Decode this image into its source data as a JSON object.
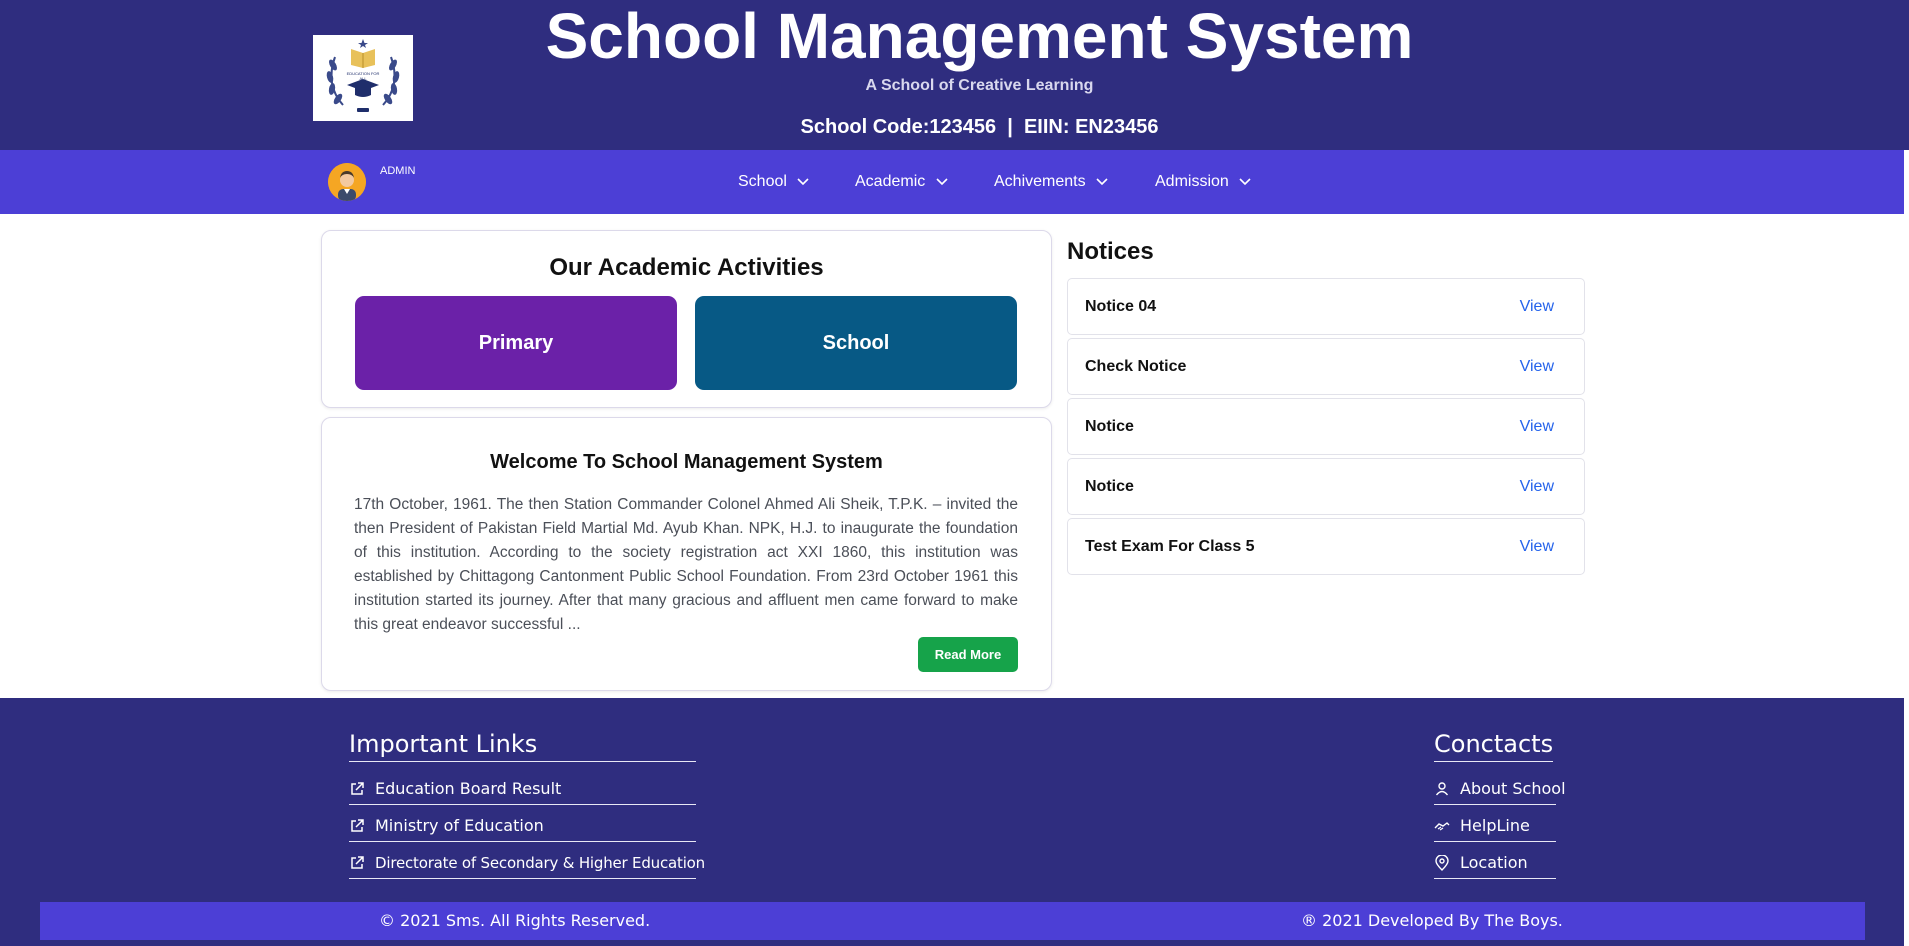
{
  "header": {
    "title": "School Management System",
    "subtitle": "A School of Creative Learning",
    "code_line": "School Code:123456  |  EIIN: EN23456",
    "logo_text": "EDUCATION FOR ALL"
  },
  "navbar": {
    "user_label": "ADMIN",
    "items": [
      {
        "label": "School"
      },
      {
        "label": "Academic"
      },
      {
        "label": "Achivements"
      },
      {
        "label": "Admission"
      }
    ]
  },
  "activities": {
    "title": "Our Academic Activities",
    "buttons": [
      {
        "label": "Primary",
        "color": "#6b21a8"
      },
      {
        "label": "School",
        "color": "#075985"
      }
    ]
  },
  "welcome": {
    "title": "Welcome To School Management System",
    "body": "17th October, 1961. The then Station Commander Colonel Ahmed Ali Sheik, T.P.K. – invited the then President of Pakistan Field Martial Md. Ayub Khan. NPK, H.J. to inaugurate the foundation of this institution. According to the society registration act XXI 1860, this institution was established by Chittagong Cantonment Public School Foundation. From 23rd October 1961 this institution started its journey. After that many gracious and affluent men came forward to make this great endeavor successful ...",
    "read_more": "Read More"
  },
  "notices": {
    "title": "Notices",
    "view_label": "View",
    "items": [
      {
        "name": "Notice 04"
      },
      {
        "name": "Check Notice"
      },
      {
        "name": "Notice"
      },
      {
        "name": "Notice"
      },
      {
        "name": "Test Exam For Class 5"
      }
    ]
  },
  "footer": {
    "links_title": "Important Links",
    "links": [
      {
        "label": "Education Board Result",
        "icon": "external-link-icon"
      },
      {
        "label": "Ministry of Education",
        "icon": "external-link-icon"
      },
      {
        "label": "Directorate of Secondary & Higher Education",
        "icon": "external-link-icon"
      }
    ],
    "contacts_title": "Conctacts",
    "contacts": [
      {
        "label": "About School",
        "icon": "user-icon"
      },
      {
        "label": "HelpLine",
        "icon": "handshake-icon"
      },
      {
        "label": "Location",
        "icon": "location-pin-icon"
      }
    ],
    "copyright": "© 2021 Sms. All Rights Reserved.",
    "developed": "® 2021 Developed By The Boys."
  },
  "colors": {
    "header_bg": "#2f2d7f",
    "nav_bg": "#4c3fd6",
    "read_more_bg": "#16a34a",
    "link_color": "#2563eb"
  }
}
